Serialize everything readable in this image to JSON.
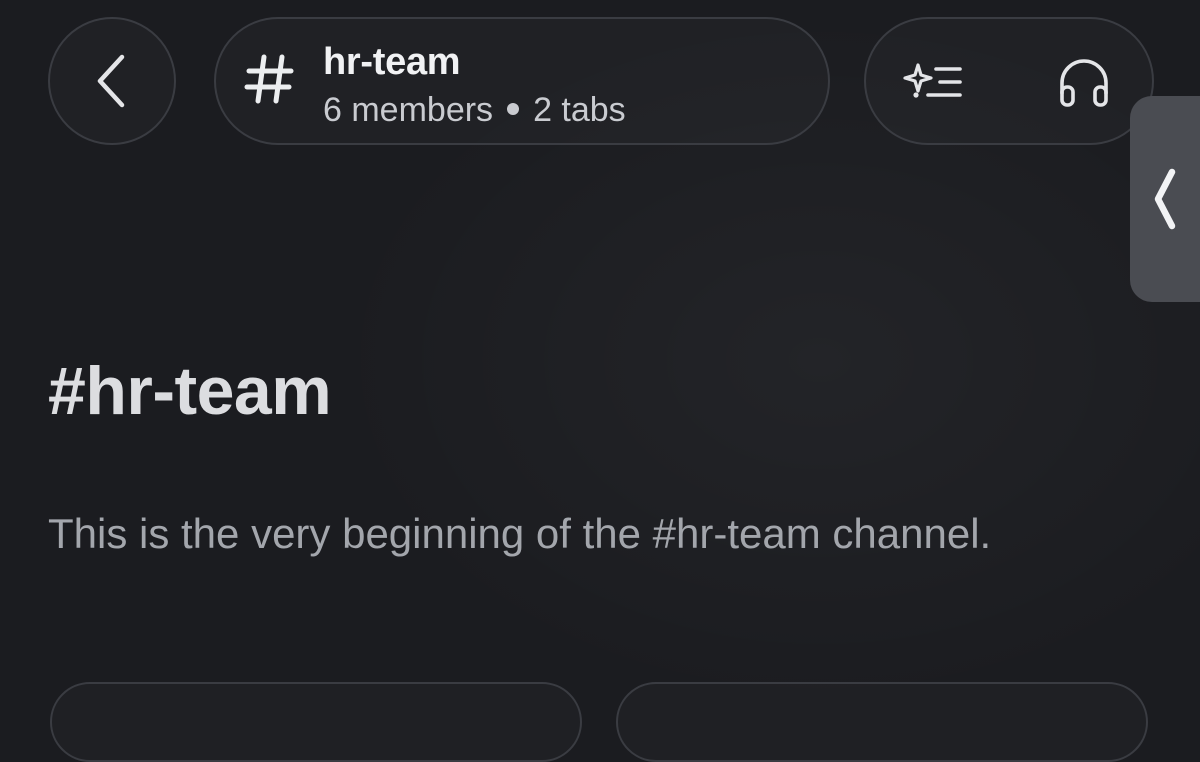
{
  "header": {
    "back_icon": "chevron-left-icon",
    "channel": {
      "hash_icon": "hash-icon",
      "name": "hr-team",
      "members": "6 members",
      "tabs": "2 tabs"
    },
    "actions": {
      "ai_icon": "sparkle-list-icon",
      "huddle_icon": "headphones-icon"
    }
  },
  "drawer_handle": {
    "icon": "chevron-left-icon"
  },
  "main": {
    "title": "#hr-team",
    "intro": "This is the very beginning of the #hr-team channel."
  },
  "colors": {
    "background": "#1b1c20",
    "border": "#3a3c42",
    "handle": "#4a4c52"
  }
}
